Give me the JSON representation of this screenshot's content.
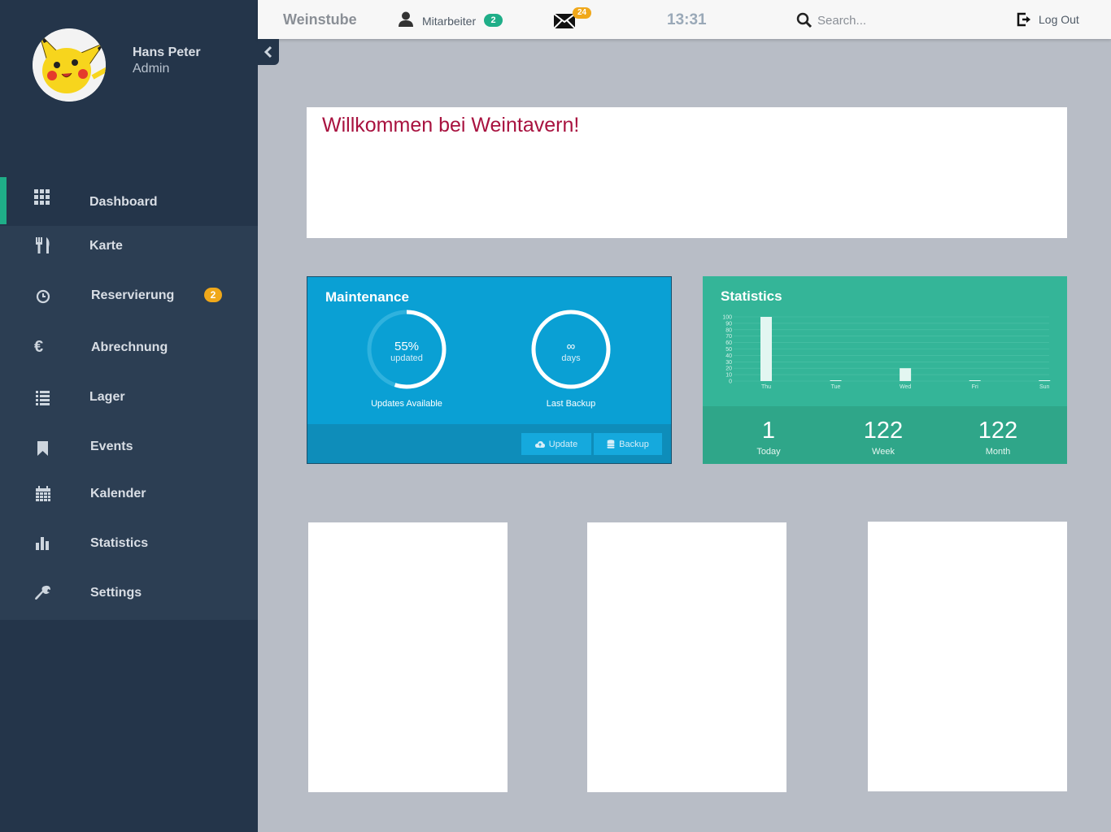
{
  "profile": {
    "name": "Hans Peter",
    "role": "Admin"
  },
  "sidebar": {
    "items": [
      {
        "label": "Dashboard",
        "icon": "grid-icon",
        "active": true
      },
      {
        "label": "Karte",
        "icon": "fork-knife-icon"
      },
      {
        "label": "Reservierung",
        "icon": "clock-icon",
        "badge": "2"
      },
      {
        "label": "Abrechnung",
        "icon": "euro-icon"
      },
      {
        "label": "Lager",
        "icon": "list-icon"
      },
      {
        "label": "Events",
        "icon": "bookmark-icon"
      },
      {
        "label": "Kalender",
        "icon": "calendar-icon"
      },
      {
        "label": "Statistics",
        "icon": "bar-chart-icon"
      },
      {
        "label": "Settings",
        "icon": "wrench-icon"
      }
    ]
  },
  "header": {
    "brand": "Weinstube",
    "staff_label": "Mitarbeiter",
    "staff_count": "2",
    "mail_count": "24",
    "time": "13:31",
    "search_placeholder": "Search...",
    "logout": "Log Out"
  },
  "welcome": {
    "title": "Willkommen bei Weintavern!"
  },
  "maintenance": {
    "title": "Maintenance",
    "updates": {
      "value": "55%",
      "sub": "updated",
      "caption": "Updates Available",
      "progress": 0.55
    },
    "backup": {
      "value": "∞",
      "sub": "days",
      "caption": "Last Backup",
      "progress": 1.0
    },
    "buttons": {
      "update": "Update",
      "backup": "Backup"
    }
  },
  "statistics": {
    "title": "Statistics",
    "today": {
      "value": "1",
      "label": "Today"
    },
    "week": {
      "value": "122",
      "label": "Week"
    },
    "month": {
      "value": "122",
      "label": "Month"
    }
  },
  "colors": {
    "sidebar_bg": "#24354a",
    "accent_green": "#1fae88",
    "badge_orange": "#f0a81a",
    "maintenance_bg": "#0aa0d4",
    "statistics_bg": "#34b598",
    "welcome_title": "#a8123f"
  },
  "chart_data": {
    "type": "bar",
    "categories": [
      "Thu",
      "Tue",
      "Wed",
      "Fri",
      "Sun"
    ],
    "values": [
      100,
      0,
      20,
      0,
      0
    ],
    "yticks": [
      "100",
      "90",
      "80",
      "70",
      "60",
      "50",
      "40",
      "30",
      "20",
      "10",
      "0"
    ],
    "ylim": [
      0,
      100
    ],
    "grid": true
  }
}
